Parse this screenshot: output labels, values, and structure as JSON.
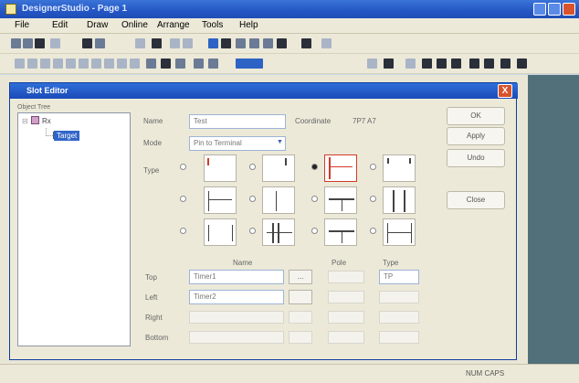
{
  "window": {
    "title": "DesignerStudio - Page 1",
    "accent": "#2456c4"
  },
  "menu": {
    "items": [
      "File",
      "Edit",
      "Draw",
      "Online",
      "Arrange",
      "Tools",
      "Help"
    ]
  },
  "dialog": {
    "title": "Slot Editor",
    "close_label": "X",
    "tree": {
      "header": "Object Tree",
      "root": "Rx",
      "child": "Target"
    },
    "buttons": {
      "ok": "OK",
      "apply": "Apply",
      "undo": "Undo",
      "close": "Close"
    },
    "form": {
      "name_label": "Name",
      "name_value": "Test",
      "coord_label": "Coordinate",
      "coord_value": "7P7 A7",
      "mode_label": "Mode",
      "mode_value": "Pin to Terminal",
      "type_label": "Type"
    },
    "table": {
      "headers": [
        "Name",
        "Pole",
        "Type"
      ],
      "rows": [
        {
          "label": "Top",
          "name": "Timer1",
          "type": "TP"
        },
        {
          "label": "Left",
          "name": "Timer2",
          "type": ""
        },
        {
          "label": "Right",
          "name": "",
          "type": ""
        },
        {
          "label": "Bottom",
          "name": "",
          "type": ""
        }
      ]
    }
  },
  "statusbar": {
    "text": "NUM  CAPS"
  }
}
